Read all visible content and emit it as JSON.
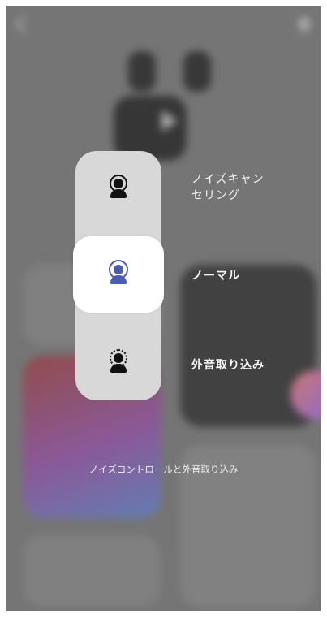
{
  "modes": [
    {
      "label": "ノイズキャン\nセリング",
      "icon": "noise-cancel-icon",
      "selected": false
    },
    {
      "label": "ノーマル",
      "icon": "normal-person-icon",
      "selected": true
    },
    {
      "label": "外音取り込み",
      "icon": "ambient-person-icon",
      "selected": false
    }
  ],
  "caption": "ノイズコントロールと外音取り込み",
  "colors": {
    "selected_icon": "#4a5cb3",
    "pill_bg": "#d8d8d8",
    "selected_bg": "#ffffff"
  }
}
